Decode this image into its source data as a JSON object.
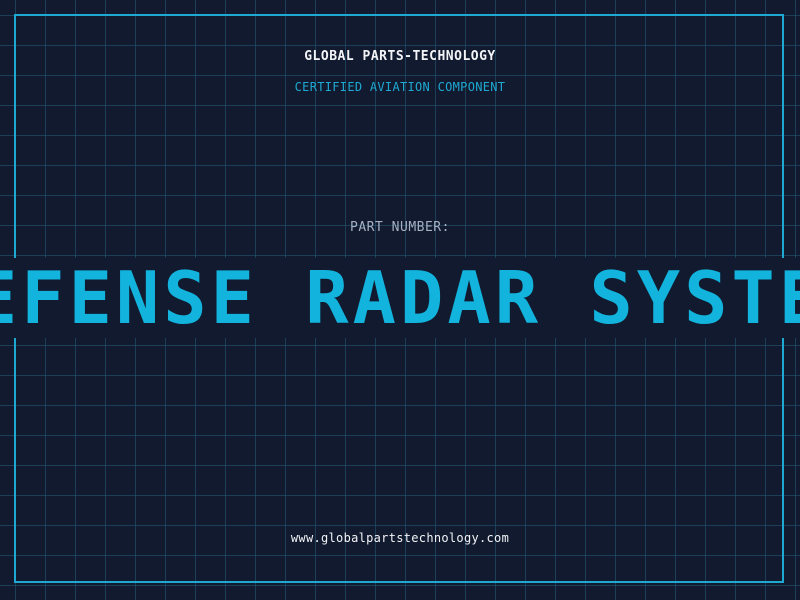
{
  "company_name": "GLOBAL PARTS-TECHNOLOGY",
  "tagline": "CERTIFIED AVIATION COMPONENT",
  "part_number_label": "PART NUMBER:",
  "part_number_value": "DEFENSE RADAR SYSTEM",
  "website": "www.globalpartstechnology.com",
  "colors": {
    "background": "#111a2e",
    "grid": "#245c78",
    "accent": "#1ea9d3",
    "text": "#f2f4f7",
    "muted": "#a5b0c2"
  }
}
